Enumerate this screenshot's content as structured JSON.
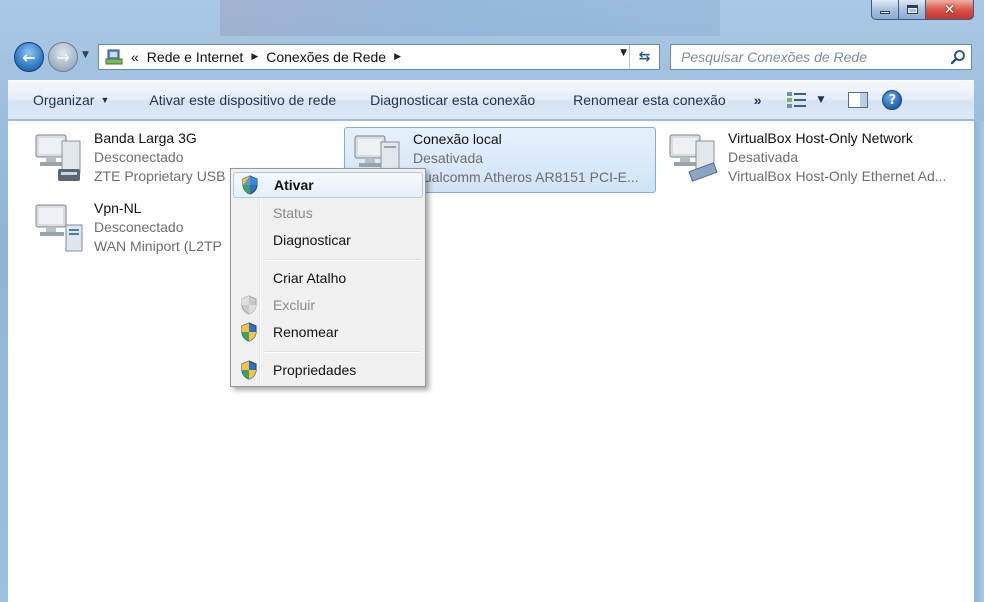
{
  "window": {
    "close_glyph": "✕"
  },
  "nav": {
    "back_glyph": "←",
    "forward_glyph": "→",
    "breadcrumb_prefix": "«",
    "breadcrumb": [
      "Rede e Internet",
      "Conexões de Rede"
    ],
    "search_placeholder": "Pesquisar Conexões de Rede"
  },
  "toolbar": {
    "organize": "Organizar",
    "enable_device": "Ativar este dispositivo de rede",
    "diagnose": "Diagnosticar esta conexão",
    "rename": "Renomear esta conexão",
    "more": "»",
    "help": "?"
  },
  "connections": [
    {
      "name": "Banda Larga 3G",
      "status": "Desconectado",
      "device": "ZTE Proprietary USB"
    },
    {
      "name": "Conexão local",
      "status": "Desativada",
      "device": "Qualcomm Atheros AR8151 PCI-E..."
    },
    {
      "name": "VirtualBox Host-Only Network",
      "status": "Desativada",
      "device": "VirtualBox Host-Only Ethernet Ad..."
    },
    {
      "name": "Vpn-NL",
      "status": "Desconectado",
      "device": "WAN Miniport (L2TP)"
    }
  ],
  "context_menu": {
    "items": [
      {
        "label": "Ativar",
        "icon": "uac-shield-icon"
      },
      {
        "label": "Status",
        "icon": ""
      },
      {
        "label": "Diagnosticar",
        "icon": ""
      },
      {
        "label": "Criar Atalho",
        "icon": ""
      },
      {
        "label": "Excluir",
        "icon": "uac-shield-icon"
      },
      {
        "label": "Renomear",
        "icon": "uac-shield-icon"
      },
      {
        "label": "Propriedades",
        "icon": "uac-shield-icon"
      }
    ]
  },
  "colors": {
    "selection": "#cfe3f8",
    "selection_border": "#84acd9",
    "toolbar_text": "#1e3350"
  }
}
